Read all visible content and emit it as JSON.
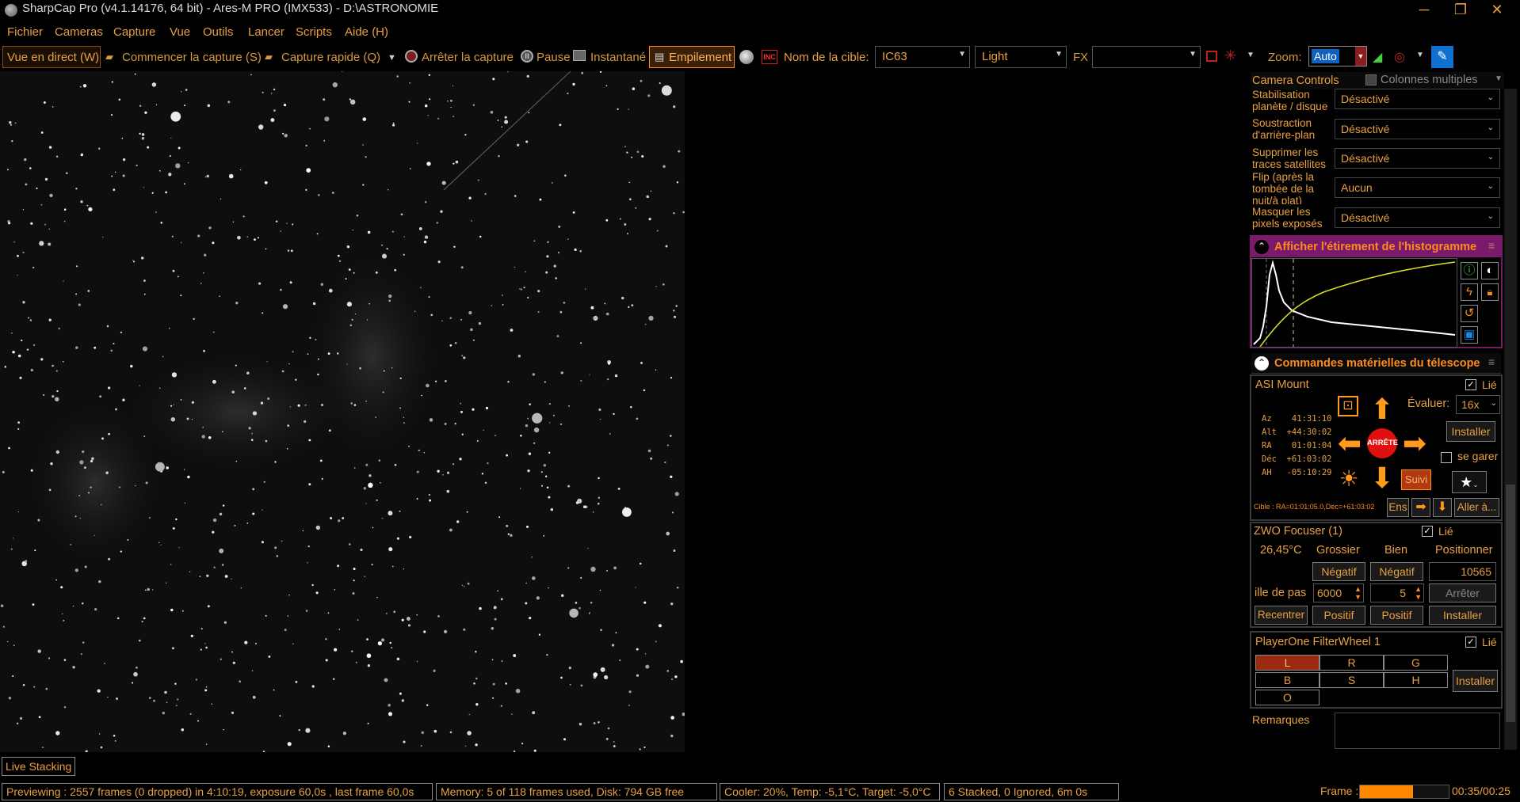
{
  "window": {
    "title": "SharpCap Pro (v4.1.14176, 64 bit) - Ares-M PRO (IMX533) - D:\\ASTRONOMIE",
    "minimize": "─",
    "restore": "❐",
    "close": "✕"
  },
  "menu": [
    "Fichier",
    "Cameras",
    "Capture",
    "Vue",
    "Outils",
    "Lancer",
    "Scripts",
    "Aide (H)"
  ],
  "toolbar": {
    "live_view": "Vue en direct (W)",
    "start_capture": "Commencer la capture (S)",
    "quick_capture": "Capture rapide (Q)",
    "stop_capture": "Arrêter la capture",
    "pause": "Pause",
    "snapshot": "Instantané",
    "stacking": "Empilement",
    "target_label": "Nom de la cible:",
    "target_value": "IC63",
    "frame_type": "Light",
    "fx_label": "FX",
    "fx_value": "",
    "zoom_label": "Zoom:",
    "zoom_value": "Auto"
  },
  "camera_controls": {
    "title": "Camera Controls",
    "multi_columns": "Colonnes multiples",
    "rows": [
      {
        "label": "Stabilisation planète / disque",
        "value": "Désactivé"
      },
      {
        "label": "Soustraction d'arrière-plan",
        "value": "Désactivé"
      },
      {
        "label": "Supprimer les traces satellites",
        "value": "Désactivé"
      },
      {
        "label": "Flip (après la tombée de la nuit/à plat)",
        "value": "Aucun"
      },
      {
        "label": "Masquer les pixels exposés",
        "value": "Désactivé"
      }
    ]
  },
  "histogram": {
    "title": "Afficher l'étirement de l'histogramme"
  },
  "telescope": {
    "title": "Commandes matérielles du télescope",
    "mount_name": "ASI Mount",
    "linked": "Lié",
    "rate_label": "Évaluer:",
    "rate_value": "16x",
    "install": "Installer",
    "park": "se garer",
    "stop": "ARRÊTE",
    "track": "Suivi",
    "coords": "Az    41:31:10\nAlt  +44:30:02\nRA    01:01:04\nDéc  +61:03:02\nAH   -05:10:29",
    "target_line": "Cible : RA=01:01:05.0,Dec=+61:03:02",
    "ens": "Ens",
    "goto": "Aller à..."
  },
  "focuser": {
    "name": "ZWO Focuser (1)",
    "linked": "Lié",
    "temp": "26,45°C",
    "coarse": "Grossier",
    "fine": "Bien",
    "position_label": "Positionner",
    "negative": "Négatif",
    "negative2": "Négatif",
    "position": "10565",
    "step_label": "ille de pas",
    "coarse_step": "6000",
    "fine_step": "5",
    "stop": "Arrêter",
    "recenter": "Recentrer",
    "positive": "Positif",
    "positive2": "Positif",
    "install": "Installer"
  },
  "filterwheel": {
    "name": "PlayerOne FilterWheel 1",
    "linked": "Lié",
    "filters": [
      "L",
      "R",
      "G",
      "B",
      "S",
      "H",
      "O"
    ],
    "selected": "L",
    "install": "Installer"
  },
  "notes": {
    "label": "Remarques"
  },
  "live_stacking_tab": "Live Stacking",
  "status": {
    "preview": "Previewing : 2557 frames (0 dropped) in 4:10:19, exposure 60,0s , last frame 60,0s",
    "memory": "Memory: 5 of 118 frames used, Disk: 794 GB free",
    "cooler": "Cooler: 20%, Temp: -5,1°C, Target: -5,0°C",
    "stack": "6 Stacked, 0 Ignored, 6m 0s",
    "frame_label": "Frame :",
    "frame_progress": 0.6,
    "frame_time": "00:35/00:25"
  },
  "colors": {
    "accent": "#e8a040",
    "header_magenta": "#7a1a6a",
    "selected_filter": "#9a2a10",
    "progress": "#ff8800"
  }
}
